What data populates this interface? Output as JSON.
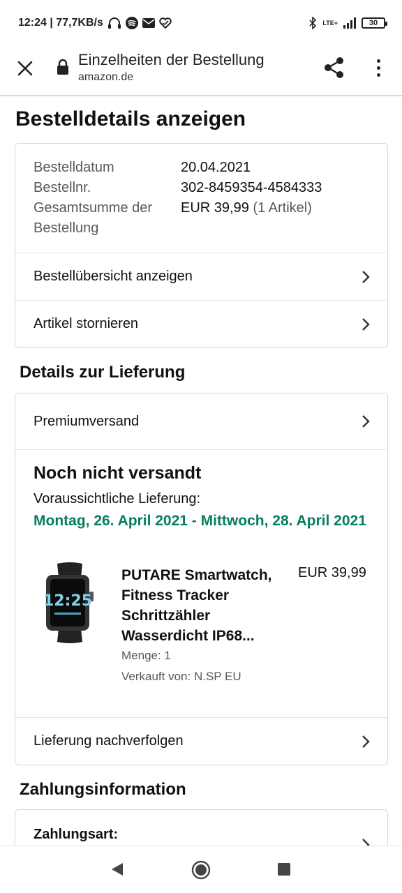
{
  "status_bar": {
    "time_speed": "12:24 | 77,7KB/s",
    "network": "LTE+",
    "battery": "30",
    "icons": [
      "headphones-icon",
      "spotify-icon",
      "mail-icon",
      "heart-icon",
      "bluetooth-icon",
      "signal-icon",
      "battery-icon"
    ]
  },
  "browser": {
    "title": "Einzelheiten der Bestellung",
    "domain": "amazon.de",
    "icons": [
      "close-icon",
      "lock-icon",
      "share-icon",
      "more-vert-icon"
    ]
  },
  "page": {
    "heading": "Bestelldetails anzeigen"
  },
  "order_summary": {
    "rows": [
      {
        "label": "Bestelldatum",
        "value": "20.04.2021"
      },
      {
        "label": "Bestellnr.",
        "value": "302-8459354-4584333"
      },
      {
        "label": "Gesamtsumme der Bestellung",
        "value": "EUR 39,99",
        "extra": "(1 Artikel)"
      }
    ],
    "links": [
      "Bestellübersicht anzeigen",
      "Artikel stornieren"
    ]
  },
  "delivery": {
    "section_title": "Details zur Lieferung",
    "shipping_method": "Premiumversand",
    "status": "Noch nicht versandt",
    "eta_label": "Voraussichtliche Lieferung:",
    "eta_date": "Montag, 26. April 2021 - Mittwoch, 28. April 2021",
    "eta_color": "#067d62",
    "item": {
      "name": "PUTARE Smartwatch, Fitness Tracker Schrittzähler Wasserdicht IP68...",
      "price": "EUR 39,99",
      "quantity": "Menge: 1",
      "seller": "Verkauft von: N.SP EU",
      "watch_time": "12:25"
    },
    "track_link": "Lieferung nachverfolgen"
  },
  "payment": {
    "section_title": "Zahlungsinformation",
    "method_label": "Zahlungsart:"
  },
  "nav_bar": {
    "icons": [
      "back-icon",
      "home-icon",
      "recents-icon"
    ]
  }
}
